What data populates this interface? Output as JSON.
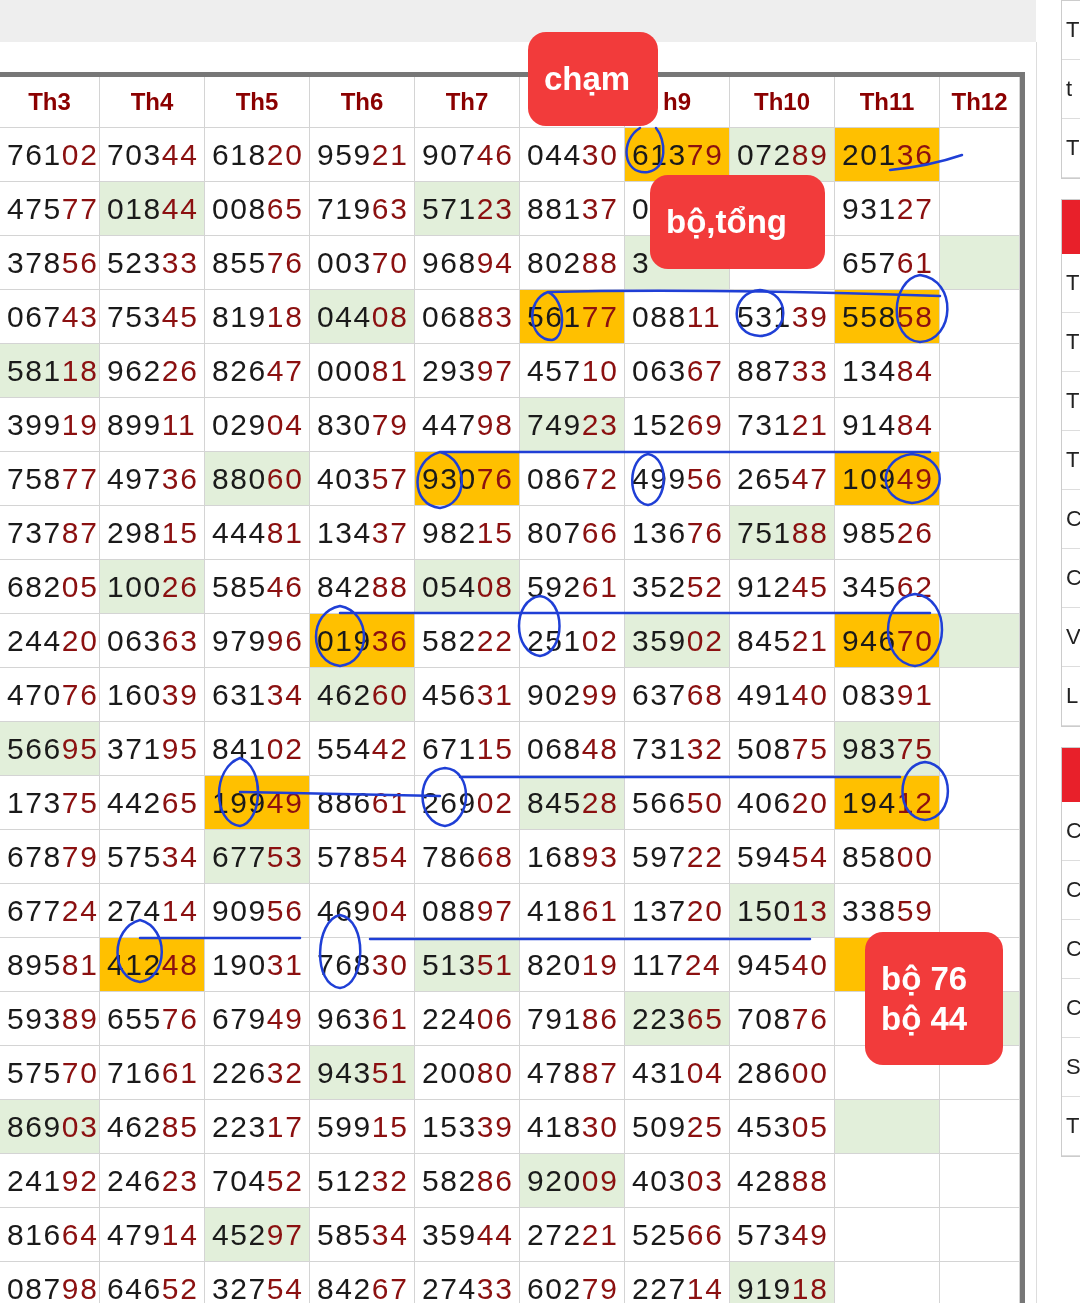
{
  "table": {
    "columns": [
      {
        "label": "Th3"
      },
      {
        "label": "Th4"
      },
      {
        "label": "Th5"
      },
      {
        "label": "Th6"
      },
      {
        "label": "Th7"
      },
      {},
      {
        "label": "h9"
      },
      {
        "label": "Th10"
      },
      {
        "label": "Th11"
      },
      {
        "label": "Th12"
      }
    ],
    "rows": [
      [
        {
          "text": "76102"
        },
        {
          "text": "70344"
        },
        {
          "text": "61820"
        },
        {
          "text": "95921"
        },
        {
          "text": "90746"
        },
        {
          "text": "04430"
        },
        {
          "text": "61379",
          "color": "#ffc000"
        },
        {
          "text": "07289",
          "color": "#e2efda"
        },
        {
          "text": "20136",
          "color": "#ffc000"
        },
        {}
      ],
      [
        {
          "text": "47577"
        },
        {
          "text": "01844",
          "color": "#e2efda"
        },
        {
          "text": "00865"
        },
        {
          "text": "71963"
        },
        {
          "text": "57123",
          "color": "#e2efda"
        },
        {
          "text": "88137"
        },
        {
          "text": "0"
        },
        {},
        {
          "text": "93127"
        },
        {}
      ],
      [
        {
          "text": "37856"
        },
        {
          "text": "52333"
        },
        {
          "text": "85576"
        },
        {
          "text": "00370"
        },
        {
          "text": "96894"
        },
        {
          "text": "80288"
        },
        {
          "text": "3",
          "color": "#e2efda"
        },
        {},
        {
          "text": "65761"
        },
        {
          "color": "#e2efda"
        }
      ],
      [
        {
          "text": "06743"
        },
        {
          "text": "75345"
        },
        {
          "text": "81918"
        },
        {
          "text": "04408",
          "color": "#e2efda"
        },
        {
          "text": "06883"
        },
        {
          "text": "56177",
          "color": "#ffc000"
        },
        {
          "text": "08811"
        },
        {
          "text": "53139"
        },
        {
          "text": "55858",
          "color": "#ffc000"
        },
        {}
      ],
      [
        {
          "text": "58118",
          "color": "#e2efda"
        },
        {
          "text": "96226"
        },
        {
          "text": "82647"
        },
        {
          "text": "00081"
        },
        {
          "text": "29397"
        },
        {
          "text": "45710"
        },
        {
          "text": "06367"
        },
        {
          "text": "88733"
        },
        {
          "text": "13484"
        },
        {}
      ],
      [
        {
          "text": "39919"
        },
        {
          "text": "89911"
        },
        {
          "text": "02904"
        },
        {
          "text": "83079"
        },
        {
          "text": "44798"
        },
        {
          "text": "74923",
          "color": "#e2efda"
        },
        {
          "text": "15269"
        },
        {
          "text": "73121"
        },
        {
          "text": "91484"
        },
        {}
      ],
      [
        {
          "text": "75877"
        },
        {
          "text": "49736"
        },
        {
          "text": "88060",
          "color": "#e2efda"
        },
        {
          "text": "40357"
        },
        {
          "text": "93076",
          "color": "#ffc000"
        },
        {
          "text": "08672"
        },
        {
          "text": "49956"
        },
        {
          "text": "26547"
        },
        {
          "text": "10949",
          "color": "#ffc000"
        },
        {}
      ],
      [
        {
          "text": "73787"
        },
        {
          "text": "29815"
        },
        {
          "text": "44481"
        },
        {
          "text": "13437"
        },
        {
          "text": "98215"
        },
        {
          "text": "80766"
        },
        {
          "text": "13676"
        },
        {
          "text": "75188",
          "color": "#e2efda"
        },
        {
          "text": "98526"
        },
        {}
      ],
      [
        {
          "text": "68205"
        },
        {
          "text": "10026",
          "color": "#e2efda"
        },
        {
          "text": "58546"
        },
        {
          "text": "84288"
        },
        {
          "text": "05408",
          "color": "#e2efda"
        },
        {
          "text": "59261"
        },
        {
          "text": "35252"
        },
        {
          "text": "91245"
        },
        {
          "text": "34562"
        },
        {}
      ],
      [
        {
          "text": "24420"
        },
        {
          "text": "06363"
        },
        {
          "text": "97996"
        },
        {
          "text": "01936",
          "color": "#ffc000"
        },
        {
          "text": "58222"
        },
        {
          "text": "25102"
        },
        {
          "text": "35902",
          "color": "#e2efda"
        },
        {
          "text": "84521"
        },
        {
          "text": "94670",
          "color": "#ffc000"
        },
        {
          "color": "#e2efda"
        }
      ],
      [
        {
          "text": "47076"
        },
        {
          "text": "16039"
        },
        {
          "text": "63134"
        },
        {
          "text": "46260",
          "color": "#e2efda"
        },
        {
          "text": "45631"
        },
        {
          "text": "90299"
        },
        {
          "text": "63768"
        },
        {
          "text": "49140"
        },
        {
          "text": "08391"
        },
        {}
      ],
      [
        {
          "text": "56695",
          "color": "#e2efda"
        },
        {
          "text": "37195"
        },
        {
          "text": "84102"
        },
        {
          "text": "55442"
        },
        {
          "text": "67115"
        },
        {
          "text": "06848"
        },
        {
          "text": "73132"
        },
        {
          "text": "50875"
        },
        {
          "text": "98375",
          "color": "#e2efda"
        },
        {}
      ],
      [
        {
          "text": "17375"
        },
        {
          "text": "44265"
        },
        {
          "text": "19949",
          "color": "#ffc000"
        },
        {
          "text": "88661"
        },
        {
          "text": "26902"
        },
        {
          "text": "84528",
          "color": "#e2efda"
        },
        {
          "text": "56650"
        },
        {
          "text": "40620"
        },
        {
          "text": "19412",
          "color": "#ffc000"
        },
        {}
      ],
      [
        {
          "text": "67879"
        },
        {
          "text": "57534"
        },
        {
          "text": "67753",
          "color": "#e2efda"
        },
        {
          "text": "57854"
        },
        {
          "text": "78668"
        },
        {
          "text": "16893"
        },
        {
          "text": "59722"
        },
        {
          "text": "59454"
        },
        {
          "text": "85800"
        },
        {}
      ],
      [
        {
          "text": "67724"
        },
        {
          "text": "27414"
        },
        {
          "text": "90956"
        },
        {
          "text": "46904"
        },
        {
          "text": "08897"
        },
        {
          "text": "41861"
        },
        {
          "text": "13720"
        },
        {
          "text": "15013",
          "color": "#e2efda"
        },
        {
          "text": "33859"
        },
        {}
      ],
      [
        {
          "text": "89581"
        },
        {
          "text": "41248",
          "color": "#ffc000"
        },
        {
          "text": "19031"
        },
        {
          "text": "76830"
        },
        {
          "text": "51351",
          "color": "#e2efda"
        },
        {
          "text": "82019"
        },
        {
          "text": "11724"
        },
        {
          "text": "94540"
        },
        {
          "color": "#ffc000"
        },
        {}
      ],
      [
        {
          "text": "59389"
        },
        {
          "text": "65576"
        },
        {
          "text": "67949"
        },
        {
          "text": "96361"
        },
        {
          "text": "22406"
        },
        {
          "text": "79186"
        },
        {
          "text": "22365",
          "color": "#e2efda"
        },
        {
          "text": "70876"
        },
        {},
        {
          "color": "#e2efda"
        }
      ],
      [
        {
          "text": "57570"
        },
        {
          "text": "71661"
        },
        {
          "text": "22632"
        },
        {
          "text": "94351",
          "color": "#e2efda"
        },
        {
          "text": "20080"
        },
        {
          "text": "47887"
        },
        {
          "text": "43104"
        },
        {
          "text": "28600"
        },
        {},
        {}
      ],
      [
        {
          "text": "86903",
          "color": "#e2efda"
        },
        {
          "text": "46285"
        },
        {
          "text": "22317"
        },
        {
          "text": "59915"
        },
        {
          "text": "15339"
        },
        {
          "text": "41830"
        },
        {
          "text": "50925"
        },
        {
          "text": "45305"
        },
        {
          "color": "#e2efda"
        },
        {}
      ],
      [
        {
          "text": "24192"
        },
        {
          "text": "24623"
        },
        {
          "text": "70452"
        },
        {
          "text": "51232"
        },
        {
          "text": "58286"
        },
        {
          "text": "92009",
          "color": "#e2efda"
        },
        {
          "text": "40303"
        },
        {
          "text": "42888"
        },
        {},
        {}
      ],
      [
        {
          "text": "81664"
        },
        {
          "text": "47914"
        },
        {
          "text": "45297",
          "color": "#e2efda"
        },
        {
          "text": "58534"
        },
        {
          "text": "35944"
        },
        {
          "text": "27221"
        },
        {
          "text": "52566"
        },
        {
          "text": "57349"
        },
        {},
        {}
      ],
      [
        {
          "text": "08798"
        },
        {
          "text": "64652"
        },
        {
          "text": "32754"
        },
        {
          "text": "84267"
        },
        {
          "text": "27433"
        },
        {
          "text": "60279"
        },
        {
          "text": "22714"
        },
        {
          "text": "91918",
          "color": "#e2efda"
        },
        {},
        {}
      ]
    ]
  },
  "callouts": [
    {
      "lines": [
        "chạm"
      ],
      "kind": "header"
    },
    {
      "lines": [
        "bộ,tổng"
      ],
      "kind": "middle"
    },
    {
      "lines": [
        "bộ 76",
        "bộ 44"
      ],
      "kind": "bottom"
    }
  ],
  "side_panel": {
    "sections": [
      {
        "header": false,
        "cells": [
          "T",
          "t",
          "T"
        ]
      },
      {
        "header": true,
        "cells": [
          "T",
          "T",
          "T",
          "T",
          "C",
          "C",
          "V",
          "L"
        ]
      },
      {
        "header": true,
        "cells": [
          "C",
          "C",
          "C",
          "C",
          "S",
          "T"
        ]
      }
    ]
  }
}
